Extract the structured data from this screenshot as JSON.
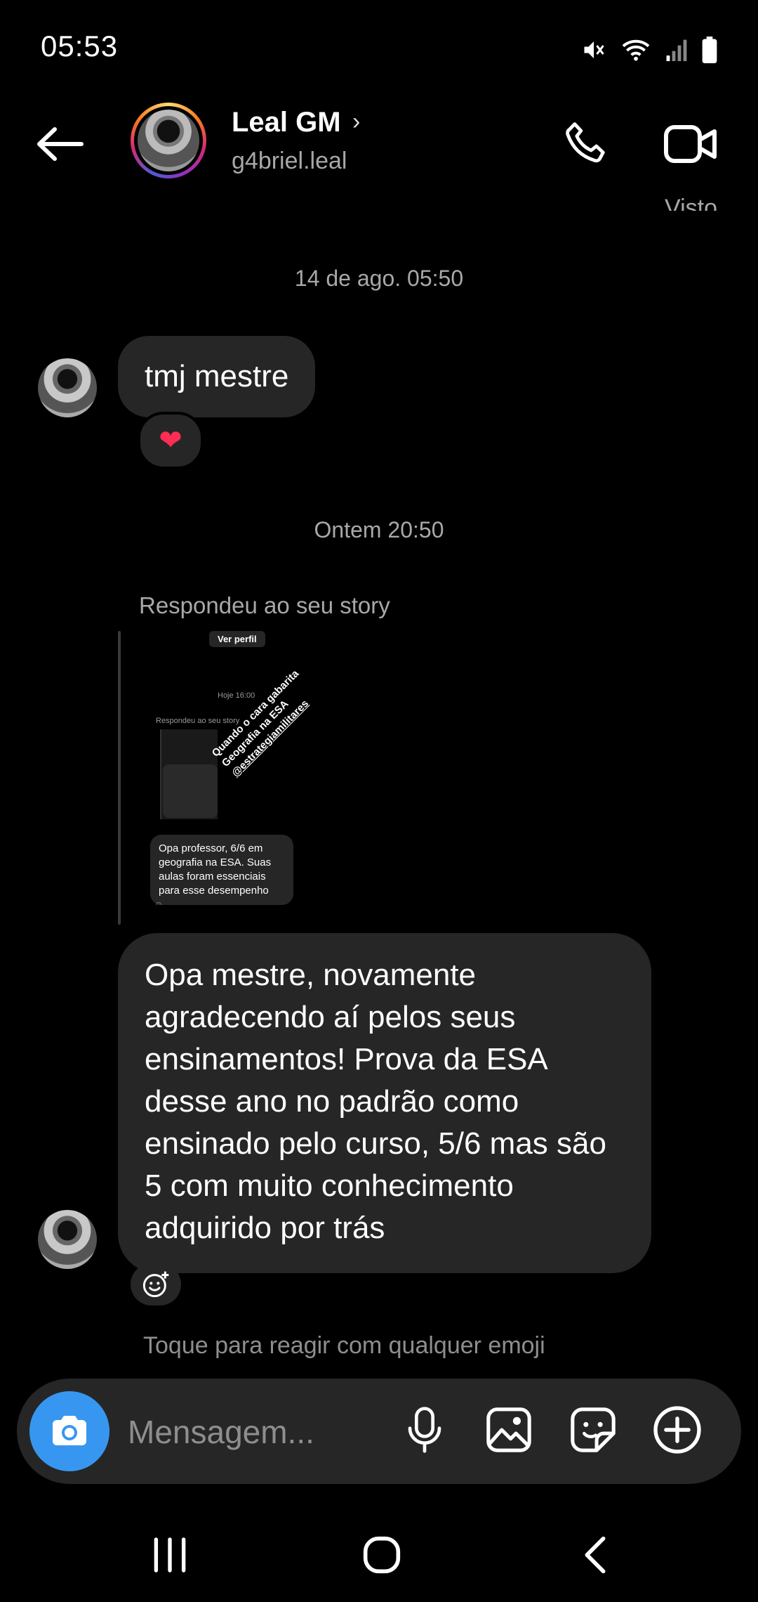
{
  "status_bar": {
    "time": "05:53",
    "icons": [
      "mute-icon",
      "wifi-icon",
      "signal-icon",
      "battery-icon"
    ]
  },
  "header": {
    "name": "Leal GM",
    "chevron": "›",
    "handle": "g4briel.leal",
    "seen": "Visto"
  },
  "conversation": {
    "timestamp_1": "14 de ago. 05:50",
    "message_1": "tmj mestre",
    "reaction_1": "❤",
    "timestamp_2": "Ontem 20:50",
    "replied_label": "Respondeu ao seu story",
    "story_preview": {
      "profile_button": "Ver perfil",
      "time": "Hoje 16:00",
      "replied_label": "Respondeu ao seu story",
      "caption_lines": [
        "Quando o cara gabarita",
        "Geografia na ESA",
        "@estrategiamilitares"
      ],
      "reply_text": "Opa professor,  6/6 em geografia na ESA. Suas aulas foram essenciais para esse desempenho"
    },
    "message_2": "Opa mestre, novamente agradecendo aí pelos seus ensinamentos! Prova da ESA desse ano no padrão como ensinado pelo curso, 5/6 mas são 5 com muito conhecimento adquirido por trás",
    "hint": "Toque para reagir com qualquer emoji"
  },
  "composer": {
    "placeholder": "Mensagem..."
  },
  "colors": {
    "background": "#000000",
    "bubble": "#262626",
    "accent": "#3797f0",
    "secondary_text": "#a8a8a8"
  }
}
